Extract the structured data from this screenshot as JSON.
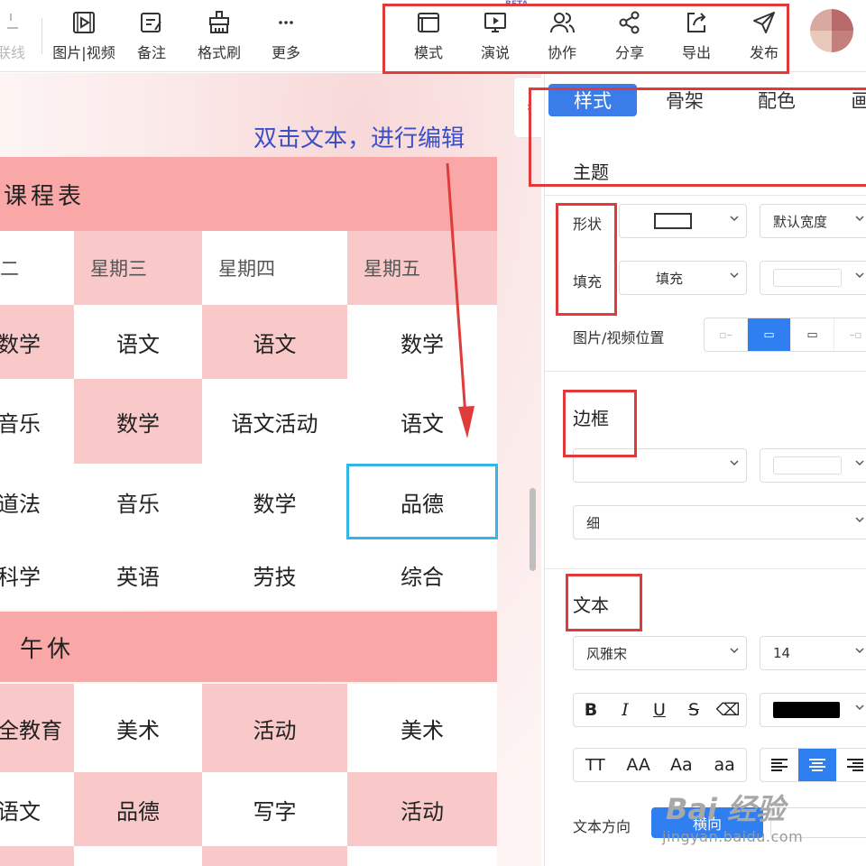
{
  "toolbar": {
    "items": [
      {
        "label": "联线",
        "icon": "link-icon"
      },
      {
        "label": "图片|视频",
        "icon": "image-video-icon"
      },
      {
        "label": "备注",
        "icon": "note-icon"
      },
      {
        "label": "格式刷",
        "icon": "format-brush-icon"
      },
      {
        "label": "更多",
        "icon": "more-icon"
      },
      {
        "label": "模式",
        "icon": "mode-icon"
      },
      {
        "label": "演说",
        "icon": "present-icon"
      },
      {
        "label": "协作",
        "icon": "collab-icon"
      },
      {
        "label": "分享",
        "icon": "share-icon"
      },
      {
        "label": "导出",
        "icon": "export-icon"
      },
      {
        "label": "发布",
        "icon": "publish-icon"
      }
    ],
    "beta": "BETA"
  },
  "canvas": {
    "hint": "双击文本，进行编辑",
    "title_banner": "课程表",
    "noon_banner": "午休",
    "days": [
      "二",
      "星期三",
      "星期四",
      "星期五"
    ],
    "rows": [
      [
        "数学",
        "语文",
        "语文",
        "数学"
      ],
      [
        "音乐",
        "数学",
        "语文活动",
        "语文"
      ],
      [
        "道法",
        "音乐",
        "数学",
        "品德"
      ],
      [
        "科学",
        "英语",
        "劳技",
        "综合"
      ]
    ],
    "rows_pm": [
      [
        "安全教育",
        "美术",
        "活动",
        "美术"
      ],
      [
        "语文",
        "品德",
        "写字",
        "活动"
      ]
    ]
  },
  "panel": {
    "tabs": [
      "样式",
      "骨架",
      "配色",
      "画"
    ],
    "theme_title": "主题",
    "shape_label": "形状",
    "fill_label": "填充",
    "fill_value": "填充",
    "width_value": "默认宽度",
    "media_pos_label": "图片/视频位置",
    "border_title": "边框",
    "border_weight": "细",
    "text_title": "文本",
    "font_value": "风雅宋",
    "font_size": "14",
    "text_color": "#000000",
    "case_buttons": [
      "TT",
      "AA",
      "Aa",
      "aa"
    ],
    "direction_label": "文本方向",
    "direction_value": "横向"
  },
  "watermark": {
    "brand": "Bai 经验",
    "url": "jingyan.baidu.com"
  },
  "colors": {
    "accent": "#3a7de8",
    "cell_pink": "#f9c9c9",
    "banner": "#f9a7a7",
    "highlight": "#e03a3a",
    "selection": "#33b5e5",
    "hint": "#3c4fc7"
  }
}
